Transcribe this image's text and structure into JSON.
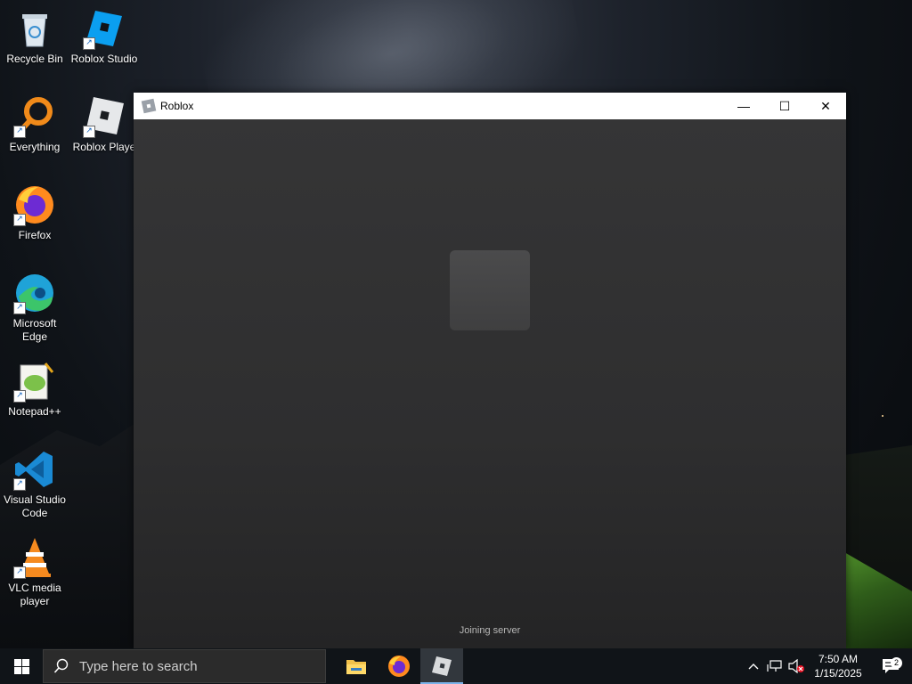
{
  "desktop": {
    "icons": [
      {
        "label": "Recycle Bin",
        "icon": "recycle-bin-icon"
      },
      {
        "label": "Roblox Studio",
        "icon": "roblox-studio-icon"
      },
      {
        "label": "Everything",
        "icon": "everything-search-icon"
      },
      {
        "label": "Roblox Playe",
        "icon": "roblox-player-icon"
      },
      {
        "label": "Firefox",
        "icon": "firefox-icon"
      },
      {
        "label": "Microsoft Edge",
        "icon": "edge-icon"
      },
      {
        "label": "Notepad++",
        "icon": "notepad-plus-plus-icon"
      },
      {
        "label": "Visual Studio Code",
        "icon": "vscode-icon"
      },
      {
        "label": "VLC media player",
        "icon": "vlc-icon"
      }
    ],
    "shortcut_glyph": "↗"
  },
  "window": {
    "title": "Roblox",
    "minimize_glyph": "—",
    "maximize_glyph": "☐",
    "close_glyph": "✕",
    "status_text": "Joining server"
  },
  "taskbar": {
    "search_placeholder": "Type here to search",
    "apps": [
      "file-explorer-icon",
      "firefox-icon",
      "roblox-icon"
    ],
    "active_app": "roblox-icon",
    "clock_time": "7:50 AM",
    "clock_date": "1/15/2025",
    "notification_count": "2",
    "tray_chevron": "^"
  },
  "colors": {
    "taskbar_bg": "#101418",
    "window_body": "#2b2b2c",
    "accent_underline": "#7ab2e8"
  }
}
